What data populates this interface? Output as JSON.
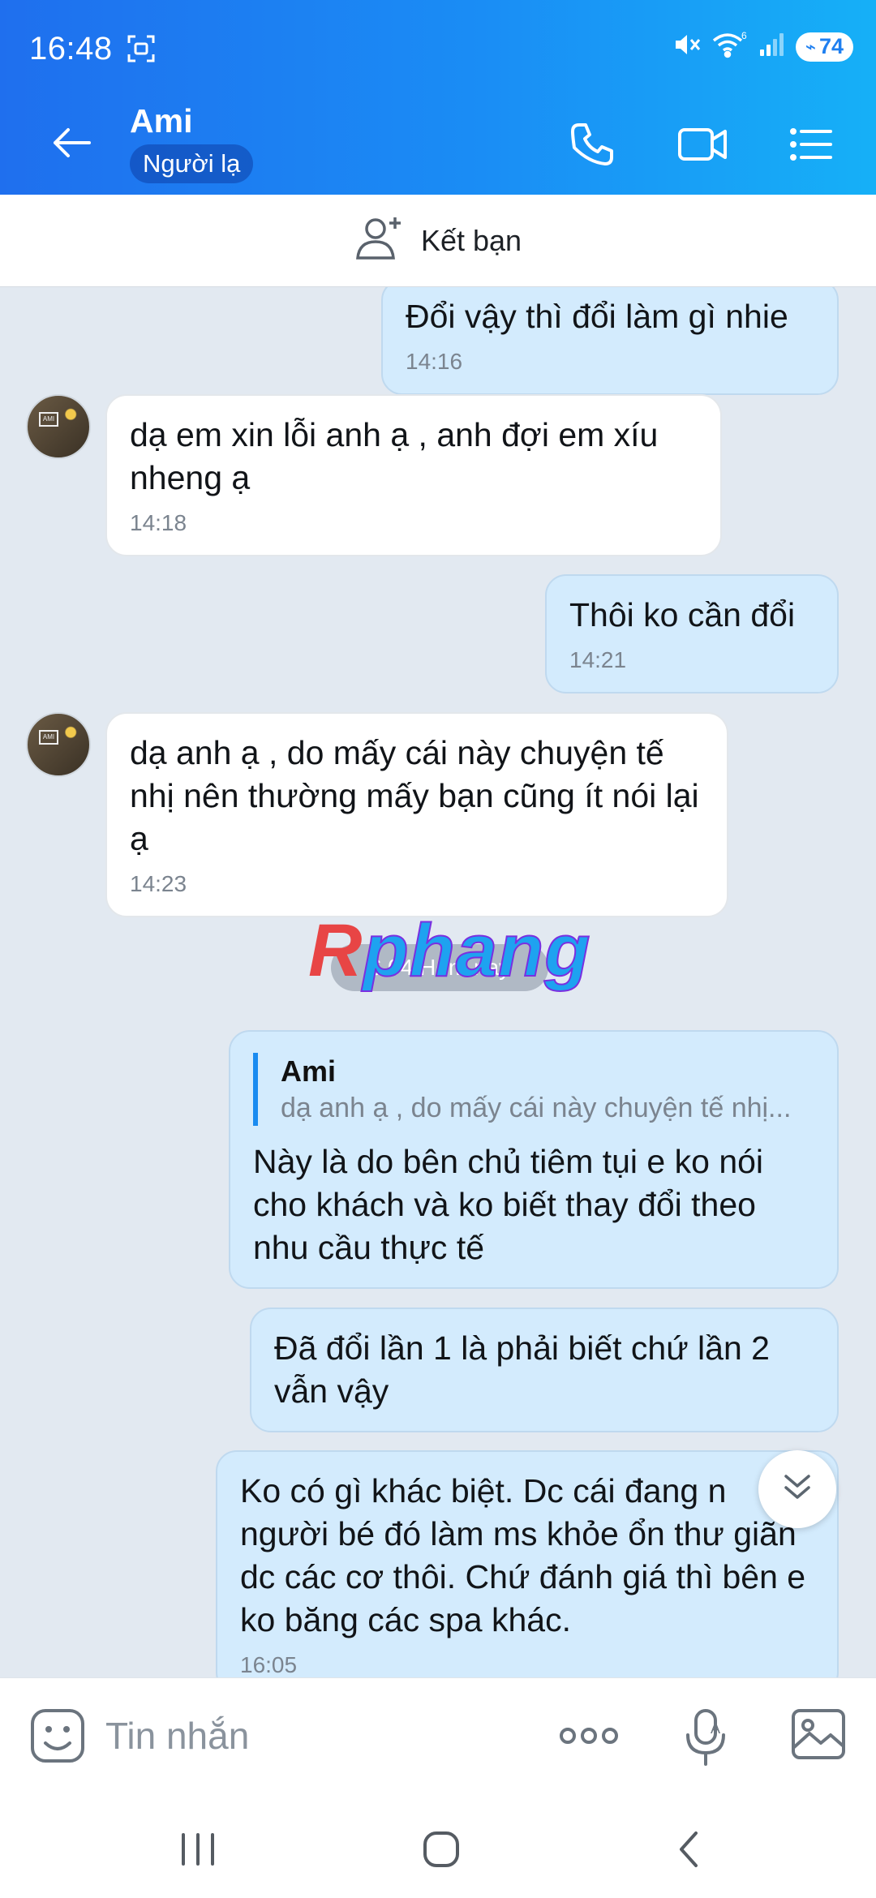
{
  "status": {
    "time": "16:48",
    "battery": "74",
    "wifi_label": "6"
  },
  "header": {
    "contact_name": "Ami",
    "contact_tag": "Người lạ"
  },
  "add_friend": {
    "label": "Kết bạn"
  },
  "messages": [
    {
      "side": "me",
      "text": "Đổi vậy thì đổi làm gì nhie",
      "time": "14:16"
    },
    {
      "side": "other",
      "text": "dạ em xin lỗi anh ạ , anh đợi em xíu nheng ạ",
      "time": "14:18"
    },
    {
      "side": "me",
      "text": "Thôi ko cần đổi",
      "time": "14:21"
    },
    {
      "side": "other",
      "text": "dạ anh ạ , do mấy cái này chuyện tế nhị nên thường mấy bạn cũng ít nói lại ạ",
      "time": "14:23"
    },
    {
      "side": "me",
      "quote_name": "Ami",
      "quote_text": "dạ anh ạ , do mấy cái này chuyện tế nhị...",
      "text": "Này là do bên chủ tiêm tụi e ko nói cho khách và ko biết thay đổi theo nhu cầu thực tế"
    },
    {
      "side": "me",
      "text": "Đã đổi lần 1 là phải biết chứ lần 2 vẫn vậy"
    },
    {
      "side": "me",
      "text": "Ko có gì khác biệt. Dc cái đang n người bé đó làm ms khỏe ổn thư giãn dc các cơ thôi. Chứ đánh giá thì bên e ko băng các spa khác.",
      "time": "16:05"
    }
  ],
  "date_divider": "6.04 Hôm nay",
  "watermark": {
    "first": "R",
    "rest": "phang"
  },
  "composer": {
    "placeholder": "Tin nhắn"
  },
  "icons": [
    "back-arrow-icon",
    "phone-icon",
    "video-icon",
    "menu-list-icon",
    "add-person-icon",
    "emoji-icon",
    "more-icon",
    "mic-icon",
    "image-icon",
    "chevron-down-icon"
  ]
}
